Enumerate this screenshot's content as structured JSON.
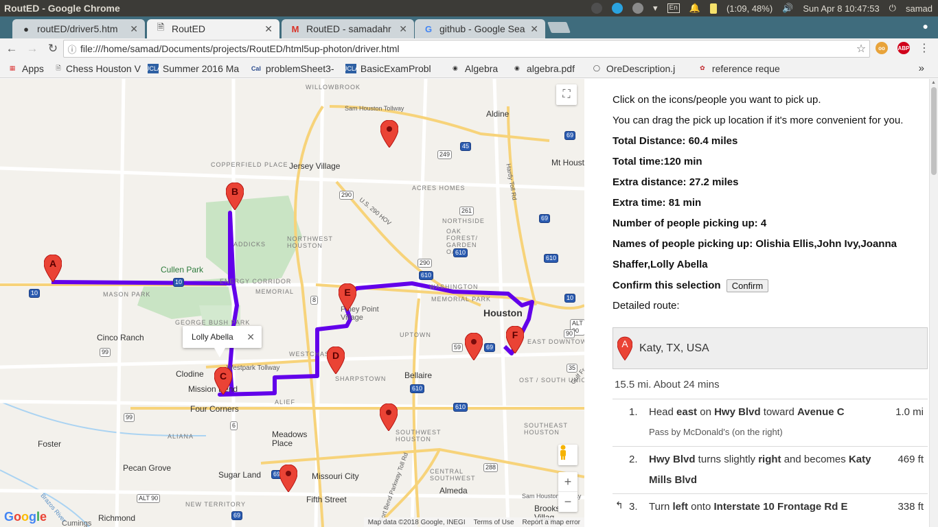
{
  "os": {
    "window_title": "RoutED - Google Chrome",
    "battery": "(1:09, 48%)",
    "clock": "Sun Apr  8 10:47:53",
    "user": "samad",
    "lang": "En"
  },
  "tabs": [
    {
      "label": "routED/driver5.htm",
      "icon": "github-icon"
    },
    {
      "label": "RoutED",
      "icon": "document-icon",
      "active": true
    },
    {
      "label": "RoutED - samadahr",
      "icon": "gmail-icon"
    },
    {
      "label": "github - Google Sea",
      "icon": "google-icon"
    }
  ],
  "toolbar": {
    "url": "file:///home/samad/Documents/projects/RoutED/html5up-photon/driver.html"
  },
  "bookmarks": [
    {
      "label": "Apps",
      "icon": "apps-grid-icon"
    },
    {
      "label": "Chess Houston V",
      "icon": "document-icon"
    },
    {
      "label": "Summer 2016 Ma",
      "icon": "ucla-icon"
    },
    {
      "label": "problemSheet3-",
      "icon": "cal-icon"
    },
    {
      "label": "BasicExamProbl",
      "icon": "ucla-icon"
    },
    {
      "label": "Algebra",
      "icon": "pdf-icon"
    },
    {
      "label": "algebra.pdf",
      "icon": "pdf-icon"
    },
    {
      "label": "OreDescription.j",
      "icon": "ore-icon"
    },
    {
      "label": "reference reque",
      "icon": "flower-icon"
    }
  ],
  "map": {
    "infowindow": "Lolly Abella",
    "markers": [
      "A",
      "B",
      "C",
      "D",
      "E",
      "F"
    ],
    "labels": {
      "willowbrook": "WILLOWBROOK",
      "sam_houston_tollway": "Sam Houston Tollway",
      "aldine": "Aldine",
      "copperfield": "COPPERFIELD PLACE",
      "jersey_village": "Jersey Village",
      "acres_homes": "ACRES HOMES",
      "mt_houston": "Mt Houst",
      "us290": "U.S. 290 HOV",
      "hardy_toll": "Hardy Toll Rd",
      "northside": "NORTHSIDE",
      "oak_forest": "OAK FOREST/ GARDEN OAKS",
      "addicks": "ADDICKS",
      "northwest_houston": "NORTHWEST HOUSTON",
      "cullen_park": "Cullen Park",
      "mason_park": "MASON PARK",
      "energy_corridor": "ENERGY CORRIDOR",
      "memorial": "MEMORIAL",
      "washington": "WASHINGTON",
      "memorial_park": "MEMORIAL PARK",
      "houston": "Houston",
      "george_bush_park": "GEORGE BUSH PARK",
      "cinco_ranch": "Cinco Ranch",
      "piney_point": "Piney Point Village",
      "uptown": "UPTOWN",
      "westchase": "WESTCHASE",
      "westpark": "Westpark Tollway",
      "clodine": "Clodine",
      "mission_bend": "Mission Bend",
      "sharpstown": "SHARPSTOWN",
      "bellaire": "Bellaire",
      "east_downtown": "EAST DOWNTOWN",
      "ost_south_union": "OST / SOUTH UNION",
      "gulf": "Gulf Fr",
      "four_corners": "Four Corners",
      "alief": "ALIEF",
      "meadows_place": "Meadows Place",
      "southwest_houston": "SOUTHWEST HOUSTON",
      "southeast_houston": "SOUTHEAST HOUSTON",
      "fulshear": "Foster",
      "aliana": "ALIANA",
      "pecan_grove": "Pecan Grove",
      "sugar_land": "Sugar Land",
      "missouri_city": "Missouri City",
      "central_southwest": "CENTRAL SOUTHWEST",
      "almeda": "Almeda",
      "new_territory": "NEW TERRITORY",
      "fifth_street": "Fifth Street",
      "fort_bend_parkway": "Fort Bend Parkway Toll Rd",
      "richmond": "Richmond",
      "cumings": "Cumings",
      "brazos": "Brazos River",
      "brookside": "Brooksi Villag"
    },
    "footer": {
      "data": "Map data ©2018 Google, INEGI",
      "terms": "Terms of Use",
      "report": "Report a map error"
    },
    "logo": "Google"
  },
  "panel": {
    "line1": "Click on the icons/people you want to pick up.",
    "line2": "You can drag the pick up location if it's more convenient for you.",
    "total_distance": "Total Distance: 60.4 miles",
    "total_time": "Total time:120 min",
    "extra_distance": "Extra distance: 27.2 miles",
    "extra_time": "Extra time: 81 min",
    "num_people": "Number of people picking up: 4",
    "names_1": "Names of people picking up: Olishia Ellis,John Ivy,Joanna",
    "names_2": "Shaffer,Lolly Abella",
    "confirm_label": "Confirm this selection",
    "confirm_button": "Confirm",
    "detailed_route": "Detailed route:",
    "start_letter": "A",
    "start_address": "Katy, TX, USA",
    "summary": "15.5 mi. About 24 mins",
    "steps": [
      {
        "num": "1.",
        "dist": "1.0 mi",
        "note": "Pass by McDonald's (on the right)"
      },
      {
        "num": "2.",
        "dist": "469 ft"
      },
      {
        "num": "3.",
        "dist": "338 ft"
      }
    ]
  }
}
